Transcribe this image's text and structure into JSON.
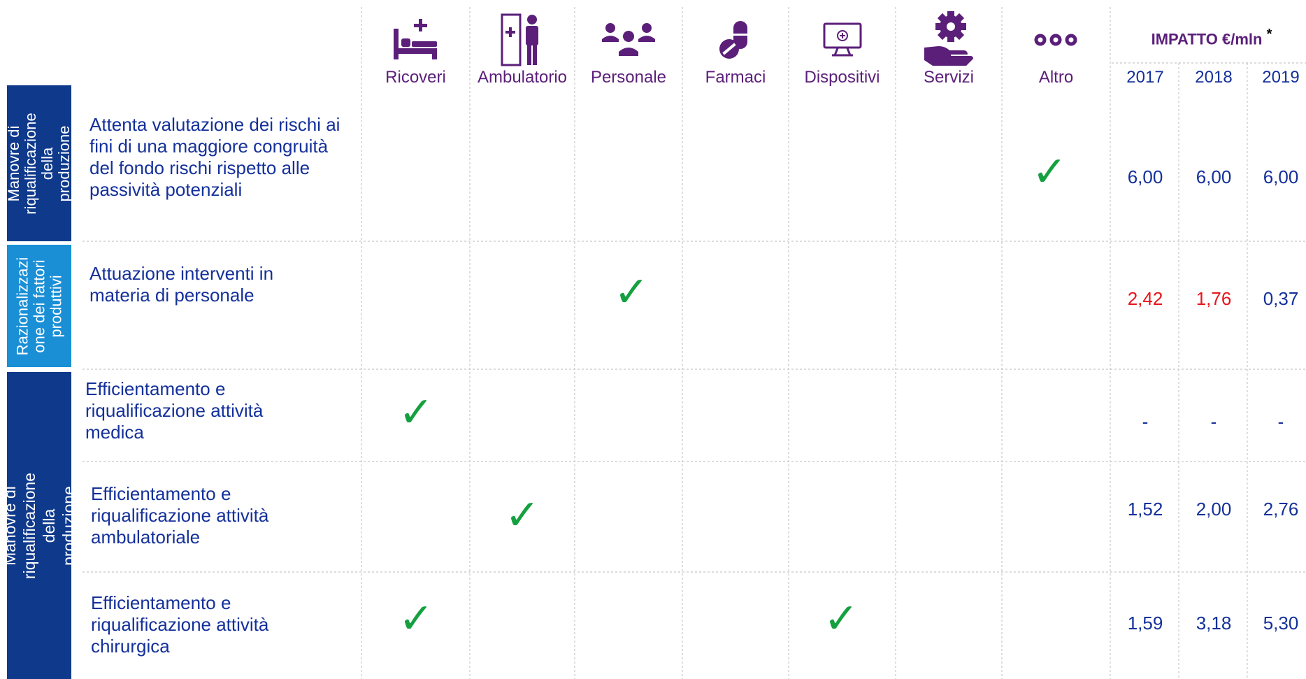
{
  "columns": [
    {
      "label": "Ricoveri",
      "icon": "hospital-bed-icon"
    },
    {
      "label": "Ambulatorio",
      "icon": "clinic-door-person-icon"
    },
    {
      "label": "Personale",
      "icon": "staff-group-icon"
    },
    {
      "label": "Farmaci",
      "icon": "pills-icon"
    },
    {
      "label": "Dispositivi",
      "icon": "monitor-device-icon"
    },
    {
      "label": "Servizi",
      "icon": "gear-hand-icon"
    },
    {
      "label": "Altro",
      "icon": "three-dots-icon"
    }
  ],
  "impact": {
    "title": "IMPATTO €/mln",
    "asterisk": "*",
    "years": [
      "2017",
      "2018",
      "2019"
    ]
  },
  "sections": [
    {
      "label": "Manovre di riqualificazione della produzione",
      "color": "#0f3a8c"
    },
    {
      "label": "Razionalizzazi one dei fattori produttivi",
      "color": "#1a8fd6"
    },
    {
      "label": "Manovre di riqualificazione della produzione",
      "color": "#0f3a8c"
    }
  ],
  "rows": [
    {
      "label": "Attenta valutazione dei rischi ai fini di una maggiore congruità del fondo rischi rispetto alle passività potenziali",
      "checks": [
        "Altro"
      ],
      "values": [
        "6,00",
        "6,00",
        "6,00"
      ],
      "value_colors": [
        "#14309a",
        "#14309a",
        "#14309a"
      ]
    },
    {
      "label": "Attuazione interventi in materia di personale",
      "checks": [
        "Personale"
      ],
      "values": [
        "2,42",
        "1,76",
        "0,37"
      ],
      "value_colors": [
        "#e8141b",
        "#e8141b",
        "#14309a"
      ]
    },
    {
      "label": "Efficientamento e riqualificazione attività medica",
      "checks": [
        "Ricoveri"
      ],
      "values": [
        "-",
        "-",
        "-"
      ],
      "value_colors": [
        "#14309a",
        "#14309a",
        "#14309a"
      ]
    },
    {
      "label": "Efficientamento e riqualificazione attività ambulatoriale",
      "checks": [
        "Ambulatorio"
      ],
      "values": [
        "1,52",
        "2,00",
        "2,76"
      ],
      "value_colors": [
        "#14309a",
        "#14309a",
        "#14309a"
      ]
    },
    {
      "label": "Efficientamento e riqualificazione attività chirurgica",
      "checks": [
        "Ricoveri",
        "Dispositivi"
      ],
      "values": [
        "1,59",
        "3,18",
        "5,30"
      ],
      "value_colors": [
        "#14309a",
        "#14309a",
        "#14309a"
      ]
    }
  ],
  "check_glyph": "✓",
  "colors": {
    "icon": "#5b1f7a",
    "check": "#15a03f",
    "text": "#14309a",
    "negative": "#e8141b"
  }
}
